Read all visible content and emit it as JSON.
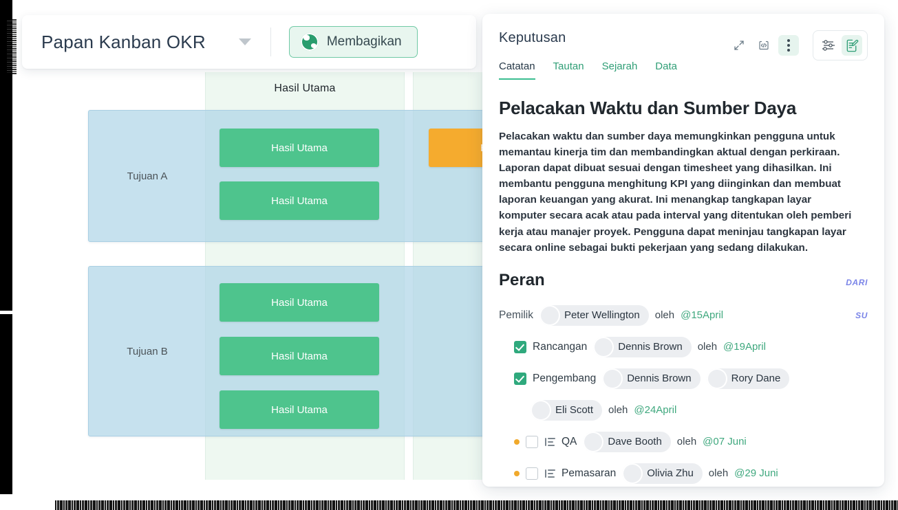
{
  "header": {
    "board_title": "Papan Kanban OKR",
    "caret_icon": "chevron-down-icon",
    "share_label": "Membagikan",
    "share_icon": "globe-icon"
  },
  "board": {
    "columns": [
      {
        "label": "Hasil Utama",
        "icon": ""
      },
      {
        "label": "",
        "icon": "image-icon"
      }
    ],
    "lanes": [
      {
        "label": "Tujuan A",
        "cards": [
          {
            "label": "Hasil Utama",
            "color": "#4ec48d"
          },
          {
            "label": "Hasil Utama",
            "color": "#4ec48d"
          },
          {
            "label": "Hasil Utama",
            "color": "#f5ab2e"
          }
        ]
      },
      {
        "label": "Tujuan B",
        "cards": [
          {
            "label": "Hasil Utama",
            "color": "#4ec48d"
          },
          {
            "label": "Hasil Utama",
            "color": "#4ec48d"
          },
          {
            "label": "Hasil Utama",
            "color": "#4ec48d"
          }
        ]
      }
    ]
  },
  "panel": {
    "title": "Keputusan",
    "tools": [
      {
        "name": "expand-icon"
      },
      {
        "name": "code-icon"
      },
      {
        "name": "more-options-icon"
      },
      {
        "name": "sliders-icon"
      },
      {
        "name": "edit-note-icon"
      }
    ],
    "tabs": [
      {
        "label": "Catatan",
        "active": true
      },
      {
        "label": "Tautan",
        "active": false
      },
      {
        "label": "Sejarah",
        "active": false
      },
      {
        "label": "Data",
        "active": false
      }
    ],
    "doc_title": "Pelacakan Waktu dan Sumber Daya",
    "doc_body": "Pelacakan waktu dan sumber daya memungkinkan pengguna untuk memantau kinerja tim dan membandingkan aktual dengan perkiraan. Laporan dapat dibuat sesuai dengan timesheet yang dihasilkan. Ini membantu pengguna menghitung KPI yang diinginkan dan membuat laporan keuangan yang akurat. Ini menangkap tangkapan layar komputer secara acak atau pada interval yang ditentukan oleh pemberi kerja atau manajer proyek. Pengguna dapat meninjau tangkapan layar secara online sebagai bukti pekerjaan yang sedang dilakukan.",
    "roles_title": "Peran",
    "meta_dari": "DARI",
    "meta_su": "SU",
    "by_word": "oleh",
    "roles": [
      {
        "label": "Pemilik",
        "people": [
          {
            "name": "Peter Wellington"
          }
        ],
        "by": "oleh",
        "date": "@15April"
      },
      {
        "label": "Rancangan",
        "people": [
          {
            "name": "Dennis Brown"
          }
        ],
        "by": "oleh",
        "date": "@19April"
      },
      {
        "label": "Pengembang",
        "people": [
          {
            "name": "Dennis Brown"
          },
          {
            "name": "Rory Dane"
          }
        ],
        "by": "",
        "date": ""
      },
      {
        "label": "",
        "people": [
          {
            "name": "Eli Scott"
          }
        ],
        "by": "oleh",
        "date": "@24April"
      },
      {
        "label": "QA",
        "people": [
          {
            "name": "Dave Booth"
          }
        ],
        "by": "oleh",
        "date": "@07 Juni"
      },
      {
        "label": "Pemasaran",
        "people": [
          {
            "name": "Olivia Zhu"
          }
        ],
        "by": "oleh",
        "date": "@29 Juni"
      }
    ]
  },
  "colors": {
    "green_card": "#4ec48d",
    "orange_card": "#f5ab2e",
    "lane_blue": "#b0d6e8",
    "column_bg": "#eef8f1",
    "accent_green": "#2f9e76",
    "meta_blue": "#7b85e8"
  }
}
